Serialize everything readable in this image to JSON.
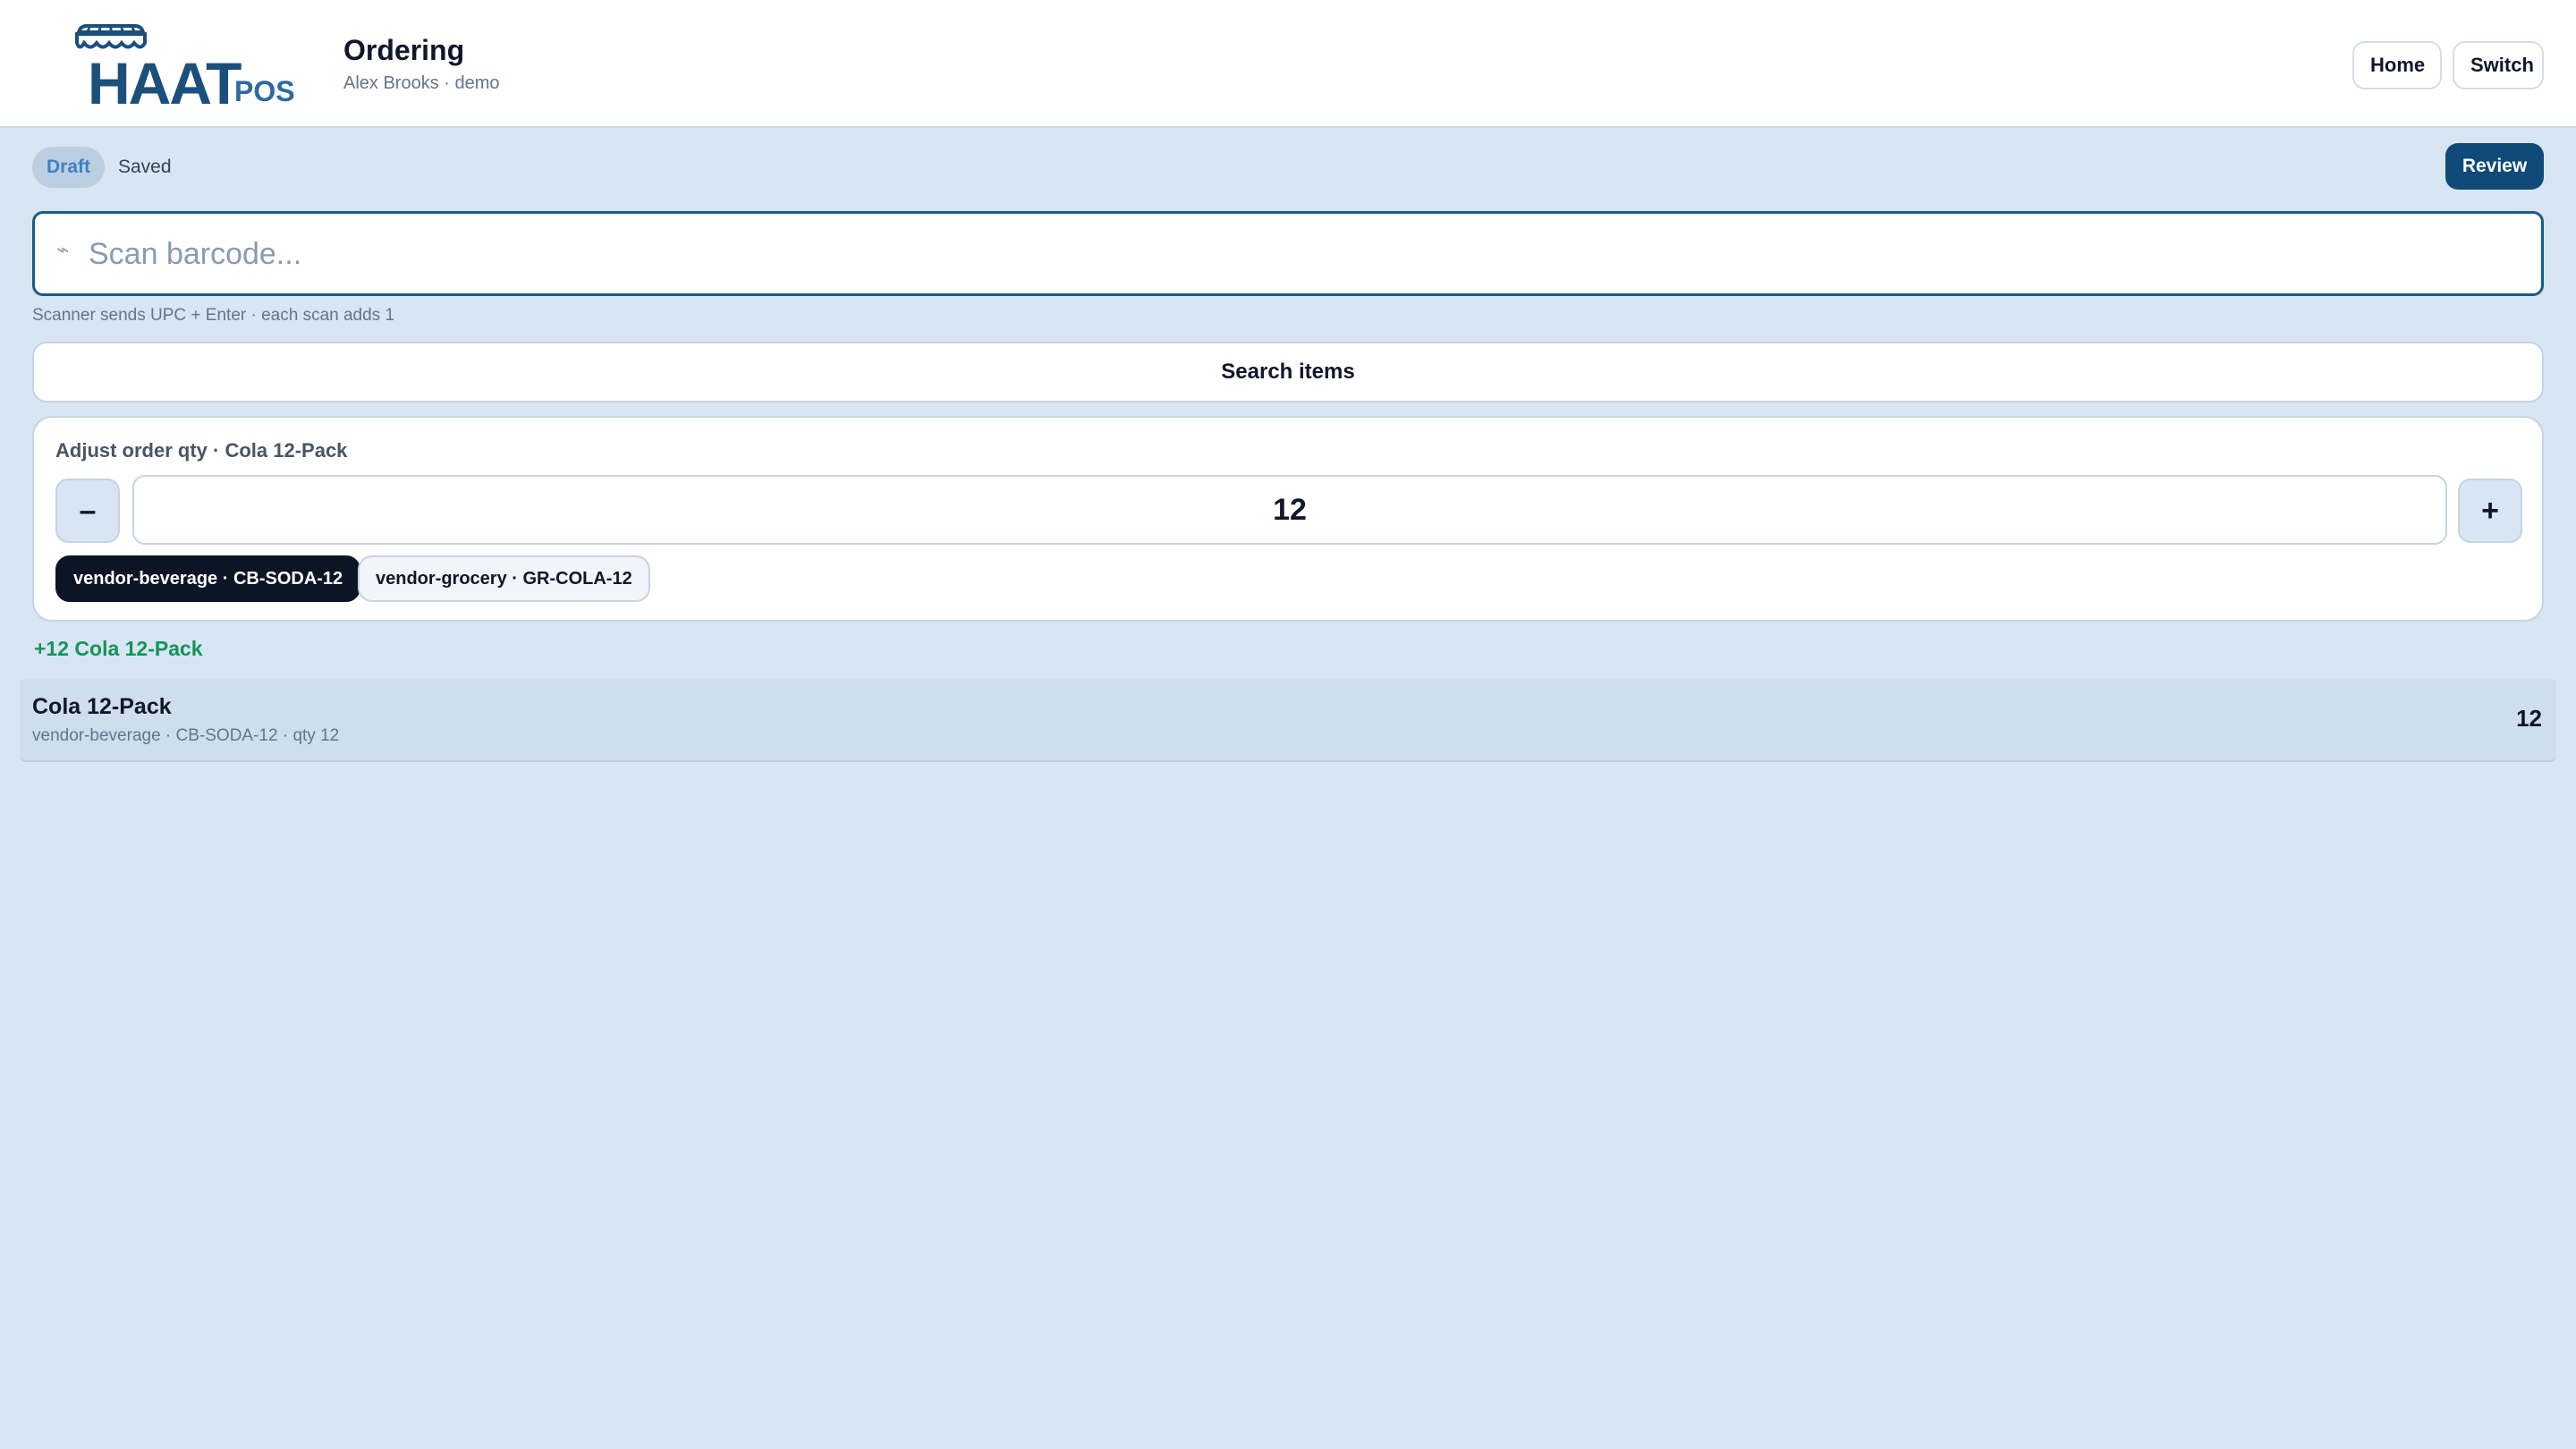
{
  "brand": {
    "logo_text": "HAAT",
    "logo_suffix": "POS"
  },
  "header": {
    "title": "Ordering",
    "subtitle": "Alex Brooks · demo",
    "home_label": "Home",
    "switch_label": "Switch"
  },
  "status": {
    "draft_label": "Draft",
    "saved_label": "Saved",
    "review_label": "Review"
  },
  "scan": {
    "placeholder": "Scan barcode...",
    "icon": "scan-icon",
    "help_text": "Scanner sends UPC + Enter · each scan adds 1"
  },
  "search": {
    "label": "Search items"
  },
  "adjust": {
    "label": "Adjust order qty · Cola 12-Pack",
    "minus_label": "–",
    "plus_label": "+",
    "quantity": "12",
    "vendors": [
      {
        "label": "vendor-beverage · CB-SODA-12",
        "selected": true
      },
      {
        "label": "vendor-grocery · GR-COLA-12",
        "selected": false
      }
    ]
  },
  "notice": {
    "text": "+12 Cola 12-Pack"
  },
  "order_items": [
    {
      "name": "Cola 12-Pack",
      "meta": "vendor-beverage · CB-SODA-12 · qty 12",
      "qty": "12"
    }
  ],
  "colors": {
    "background": "#d8e5f2",
    "brand": "#1b4f7c",
    "primary": "#0f4a78",
    "chip_active": "#0b1526",
    "success": "#15935a",
    "draft_badge": "#3b82c4"
  }
}
